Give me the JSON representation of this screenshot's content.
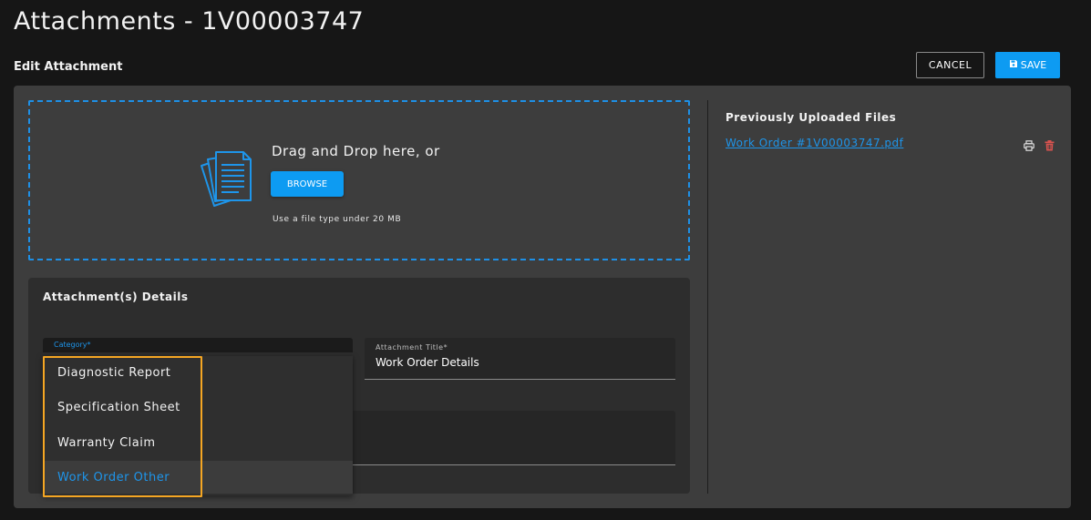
{
  "header": {
    "title": "Attachments - 1V00003747",
    "subtitle": "Edit Attachment",
    "cancel_label": "CANCEL",
    "save_label": "SAVE"
  },
  "upload": {
    "drag_text": "Drag and Drop here, or",
    "browse_label": "BROWSE",
    "hint": "Use a file type under 20 MB"
  },
  "previous_files": {
    "title": "Previously Uploaded Files",
    "files": [
      {
        "name": "Work Order #1V00003747.pdf"
      }
    ]
  },
  "details": {
    "title": "Attachment(s) Details",
    "category": {
      "label": "Category*",
      "options": [
        {
          "label": "Diagnostic Report",
          "selected": false
        },
        {
          "label": "Specification Sheet",
          "selected": false
        },
        {
          "label": "Warranty Claim",
          "selected": false
        },
        {
          "label": "Work Order Other",
          "selected": true
        }
      ]
    },
    "attachment_title": {
      "label": "Attachment Title*",
      "value": "Work Order Details"
    }
  },
  "colors": {
    "accent": "#0d9bf2",
    "link": "#1e95ea",
    "highlight": "#f5a623",
    "delete": "#d9534f"
  }
}
